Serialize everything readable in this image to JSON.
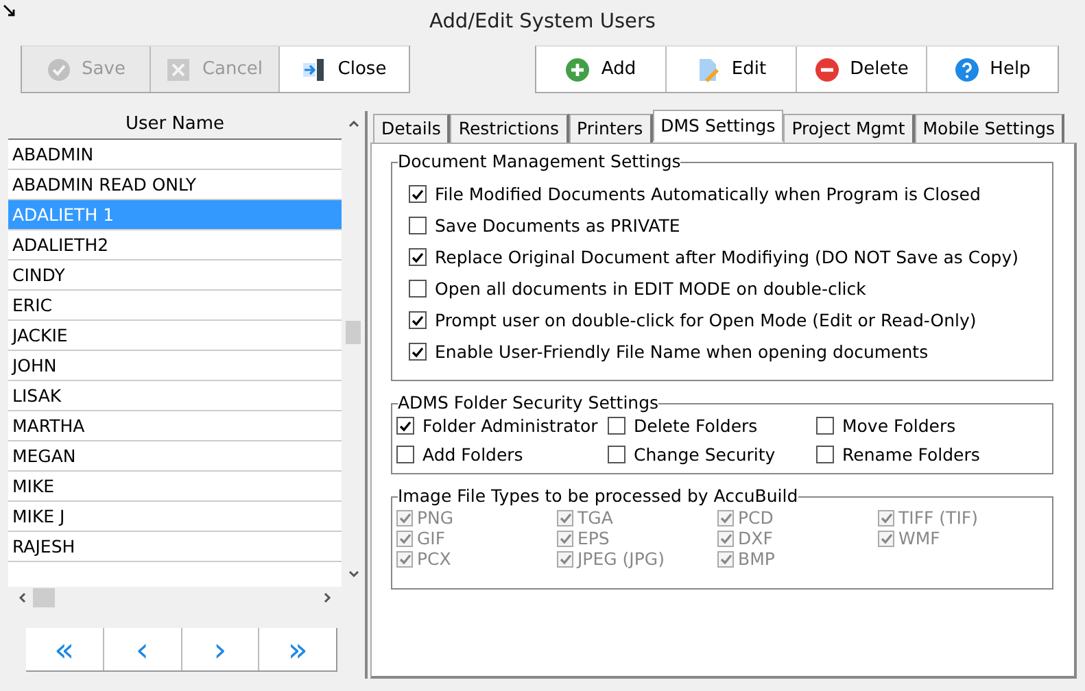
{
  "window": {
    "title": "Add/Edit System Users"
  },
  "toolbar_left": [
    {
      "kind": "save",
      "label": "Save",
      "disabled": true
    },
    {
      "kind": "cancel",
      "label": "Cancel",
      "disabled": true
    },
    {
      "kind": "close",
      "label": "Close",
      "disabled": false
    }
  ],
  "toolbar_right": [
    {
      "kind": "add",
      "label": "Add",
      "disabled": false
    },
    {
      "kind": "edit",
      "label": "Edit",
      "disabled": false
    },
    {
      "kind": "delete",
      "label": "Delete",
      "disabled": false
    },
    {
      "kind": "help",
      "label": "Help",
      "disabled": false
    }
  ],
  "user_list": {
    "column": "User Name",
    "rows": [
      {
        "name": "ABADMIN",
        "selected": false
      },
      {
        "name": "ABADMIN READ ONLY",
        "selected": false
      },
      {
        "name": "ADALIETH 1",
        "selected": true
      },
      {
        "name": "ADALIETH2",
        "selected": false
      },
      {
        "name": "CINDY",
        "selected": false
      },
      {
        "name": "ERIC",
        "selected": false
      },
      {
        "name": "JACKIE",
        "selected": false
      },
      {
        "name": "JOHN",
        "selected": false
      },
      {
        "name": "LISAK",
        "selected": false
      },
      {
        "name": "MARTHA",
        "selected": false
      },
      {
        "name": "MEGAN",
        "selected": false
      },
      {
        "name": "MIKE",
        "selected": false
      },
      {
        "name": "MIKE J",
        "selected": false
      },
      {
        "name": "RAJESH",
        "selected": false
      }
    ]
  },
  "nav_buttons": [
    "«",
    "‹",
    "›",
    "»"
  ],
  "tabs": [
    {
      "label": "Details",
      "selected": false
    },
    {
      "label": "Restrictions",
      "selected": false
    },
    {
      "label": "Printers",
      "selected": false
    },
    {
      "label": "DMS Settings",
      "selected": true
    },
    {
      "label": "Project Mgmt",
      "selected": false
    },
    {
      "label": "Mobile Settings",
      "selected": false
    }
  ],
  "document_management": {
    "title": "Document Management Settings",
    "options": [
      {
        "label": "File Modified Documents Automatically when Program is Closed",
        "checked": true
      },
      {
        "label": "Save Documents as PRIVATE",
        "checked": false
      },
      {
        "label": "Replace Original Document after Modifiying (DO NOT Save as Copy)",
        "checked": true
      },
      {
        "label": "Open all documents in EDIT MODE on double-click",
        "checked": false
      },
      {
        "label": "Prompt user on double-click for Open Mode (Edit or Read-Only)",
        "checked": true
      },
      {
        "label": "Enable User-Friendly File Name when opening documents",
        "checked": true
      }
    ]
  },
  "folder_security": {
    "title": "ADMS Folder Security Settings",
    "options": [
      {
        "label": "Folder Administrator",
        "checked": true
      },
      {
        "label": "Delete Folders",
        "checked": false
      },
      {
        "label": "Move Folders",
        "checked": false
      },
      {
        "label": "Add Folders",
        "checked": false
      },
      {
        "label": "Change Security",
        "checked": false
      },
      {
        "label": "Rename Folders",
        "checked": false
      }
    ]
  },
  "image_file_types": {
    "title": "Image File Types to be processed by AccuBuild",
    "options": [
      {
        "label": "PNG",
        "checked": true,
        "disabled": true
      },
      {
        "label": "TGA",
        "checked": true,
        "disabled": true
      },
      {
        "label": "PCD",
        "checked": true,
        "disabled": true
      },
      {
        "label": "TIFF (TIF)",
        "checked": true,
        "disabled": true
      },
      {
        "label": "GIF",
        "checked": true,
        "disabled": true
      },
      {
        "label": "EPS",
        "checked": true,
        "disabled": true
      },
      {
        "label": "DXF",
        "checked": true,
        "disabled": true
      },
      {
        "label": "WMF",
        "checked": true,
        "disabled": true
      },
      {
        "label": "PCX",
        "checked": true,
        "disabled": true
      },
      {
        "label": "JPEG (JPG)",
        "checked": true,
        "disabled": true
      },
      {
        "label": "BMP",
        "checked": true,
        "disabled": true
      }
    ]
  }
}
